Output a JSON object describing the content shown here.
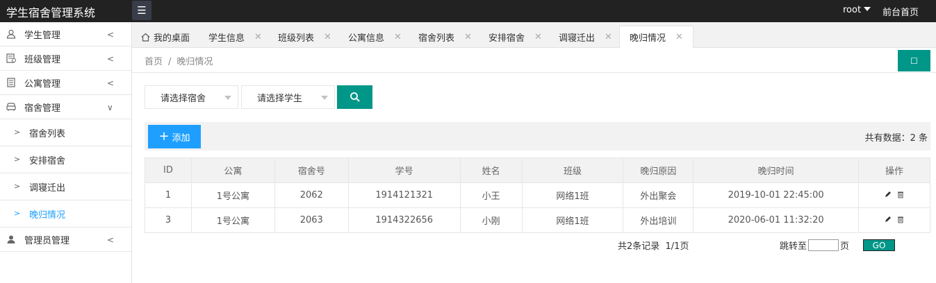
{
  "app": {
    "title": "学生宿舍管理系统"
  },
  "topbar": {
    "user": "root",
    "home_link": "前台首页"
  },
  "sidebar": {
    "items": [
      {
        "label": "学生管理",
        "icon": "user-icon"
      },
      {
        "label": "班级管理",
        "icon": "class-icon"
      },
      {
        "label": "公寓管理",
        "icon": "building-icon"
      },
      {
        "label": "宿舍管理",
        "icon": "sofa-icon"
      },
      {
        "label": "管理员管理",
        "icon": "admin-icon"
      }
    ],
    "sub_items": [
      {
        "label": "宿舍列表"
      },
      {
        "label": "安排宿舍"
      },
      {
        "label": "调寝迁出"
      },
      {
        "label": "晚归情况"
      }
    ]
  },
  "tabs": [
    {
      "label": "我的桌面"
    },
    {
      "label": "学生信息"
    },
    {
      "label": "班级列表"
    },
    {
      "label": "公寓信息"
    },
    {
      "label": "宿舍列表"
    },
    {
      "label": "安排宿舍"
    },
    {
      "label": "调寝迁出"
    },
    {
      "label": "晚归情况"
    }
  ],
  "breadcrumb": {
    "home": "首页",
    "separator": "/",
    "current": "晚归情况"
  },
  "filters": {
    "dorm_select": "请选择宿舍",
    "student_select": "请选择学生"
  },
  "toolbar": {
    "add_label": "添加",
    "total_text": "共有数据：2 条"
  },
  "table": {
    "columns": [
      "ID",
      "公寓",
      "宿舍号",
      "学号",
      "姓名",
      "班级",
      "晚归原因",
      "晚归时间",
      "操作"
    ],
    "rows": [
      {
        "id": "1",
        "apartment": "1号公寓",
        "dorm": "2062",
        "student_no": "1914121321",
        "name": "小王",
        "class": "网络1班",
        "reason": "外出聚会",
        "time": "2019-10-01 22:45:00"
      },
      {
        "id": "3",
        "apartment": "1号公寓",
        "dorm": "2063",
        "student_no": "1914322656",
        "name": "小刚",
        "class": "网络1班",
        "reason": "外出培训",
        "time": "2020-06-01 11:32:20"
      }
    ]
  },
  "pager": {
    "info": "共2条记录  1/1页",
    "jump_label": "跳转至",
    "page_unit": "页",
    "go_label": "GO"
  },
  "colors": {
    "topbar": "#222222",
    "teal": "#009688",
    "blue": "#1e9fff"
  }
}
